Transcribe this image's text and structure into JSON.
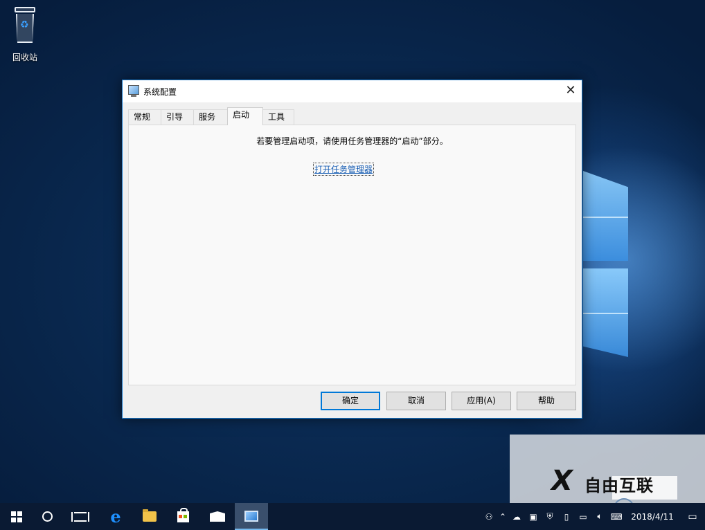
{
  "desktop": {
    "recycle_bin_label": "回收站"
  },
  "dialog": {
    "title": "系统配置",
    "tabs": [
      {
        "label": "常规"
      },
      {
        "label": "引导"
      },
      {
        "label": "服务"
      },
      {
        "label": "启动",
        "active": true
      },
      {
        "label": "工具"
      }
    ],
    "startup_message": "若要管理启动项，请使用任务管理器的“启动”部分。",
    "open_task_manager_link": "打开任务管理器",
    "buttons": {
      "ok": "确定",
      "cancel": "取消",
      "apply": "应用(A)",
      "help": "帮助"
    }
  },
  "taskbar": {
    "pinned_icons": [
      "windows-start-icon",
      "cortana-search-icon",
      "task-view-icon",
      "edge-icon",
      "file-explorer-icon",
      "store-icon",
      "mail-icon",
      "system-config-icon"
    ],
    "tray_icons": [
      "people-icon",
      "onedrive-icon",
      "vmware-icon",
      "security-icon",
      "usb-icon",
      "network-icon",
      "volume-icon",
      "keyboard-icon"
    ],
    "clock_date": "2018/4/11"
  },
  "watermark": {
    "brand_text": "自由互联"
  },
  "colors": {
    "accent": "#0078d7",
    "link": "#1a5fb4",
    "taskbar": "#0a1a33"
  }
}
